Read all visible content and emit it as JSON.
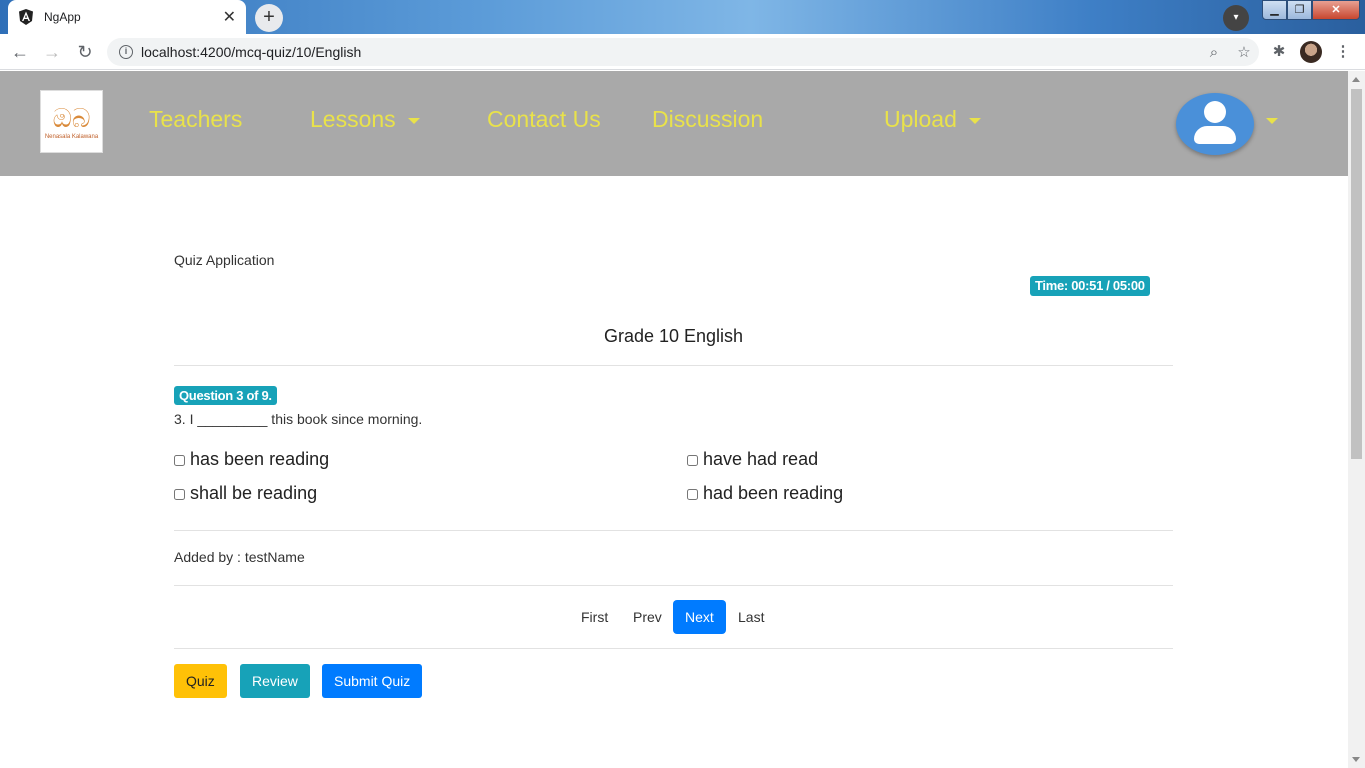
{
  "browser": {
    "tab_title": "NgApp",
    "tab_close": "✕",
    "new_tab": "+",
    "url": "localhost:4200/mcq-quiz/10/English",
    "window_controls": {
      "minimize": "▁",
      "maximize": "❐",
      "close": "✕"
    }
  },
  "navbar": {
    "logo_mark": "ඔබ",
    "logo_text": "Nenasala Kalawana",
    "links": {
      "teachers": "Teachers",
      "lessons": "Lessons",
      "contact": "Contact Us",
      "discussion": "Discussion",
      "upload": "Upload"
    },
    "accent_color": "#e9e24a",
    "background_color": "#a9a9a9"
  },
  "quiz": {
    "app_label": "Quiz Application",
    "timer": "Time: 00:51 / 05:00",
    "title": "Grade 10 English",
    "badge": "Question 3 of 9.",
    "question": "3. I _________ this book since morning.",
    "options": [
      "has been reading",
      "have had read",
      "shall be reading",
      "had been reading"
    ],
    "added_by": "Added by : testName",
    "pager": {
      "first": "First",
      "prev": "Prev",
      "next": "Next",
      "last": "Last"
    },
    "buttons": {
      "quiz": "Quiz",
      "review": "Review",
      "submit": "Submit Quiz"
    },
    "colors": {
      "info": "#17a2b8",
      "primary": "#007bff",
      "warning": "#ffc107"
    }
  }
}
